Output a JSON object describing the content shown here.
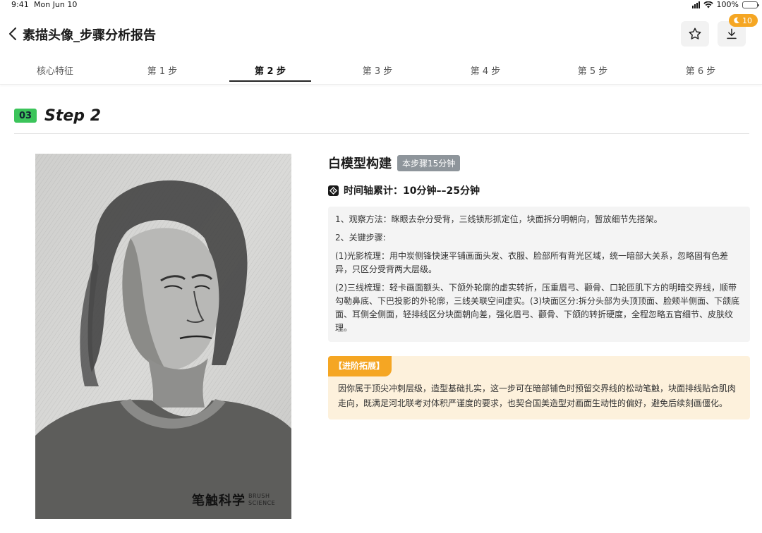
{
  "status_bar": {
    "time": "9:41",
    "date": "Mon Jun 10",
    "battery": "100%"
  },
  "header": {
    "title": "素描头像_步骤分析报告",
    "badge_count": "10"
  },
  "tabs": [
    {
      "label": "核心特征"
    },
    {
      "label": "第 1 步"
    },
    {
      "label": "第 2 步"
    },
    {
      "label": "第 3 步"
    },
    {
      "label": "第 4 步"
    },
    {
      "label": "第 5 步"
    },
    {
      "label": "第 6 步"
    }
  ],
  "active_tab": 2,
  "step": {
    "number": "03",
    "label": "Step 2"
  },
  "image": {
    "watermark_cn": "笔触科学",
    "watermark_en_1": "BRUSH",
    "watermark_en_2": "SCIENCE"
  },
  "stage": {
    "title": "白模型构建",
    "duration_tag": "本步骤15分钟",
    "timeline": "时间轴累计：10分钟––25分钟"
  },
  "method": {
    "p1": "1、观察方法：眯眼去杂分受背，三线锁形抓定位，块面拆分明朝向，暂放细节先搭架。",
    "p2": "2、关键步骤:",
    "p3": "(1)光影梳理：用中炭侧锋快速平铺画面头发、衣服、脸部所有背光区域，统一暗部大关系，忽略固有色差异，只区分受背两大层级。",
    "p4": "(2)三线梳理：轻卡画面额头、下颌外轮廓的虚实转折，压重眉弓、颧骨、口轮匝肌下方的明暗交界线，顺带勾勒鼻底、下巴投影的外轮廓，三线关联空间虚实。(3)块面区分:拆分头部为头顶顶面、脸颊半侧面、下颌底面、耳侧全侧面，轻排线区分块面朝向差，强化眉弓、颧骨、下颌的转折硬度，全程忽略五官细节、皮肤纹理。"
  },
  "advance": {
    "tag": "【进阶拓展】",
    "text": "因你属于顶尖冲刺层级，造型基础扎实，这一步可在暗部铺色时预留交界线的松动笔触，块面排线贴合肌肉走向，既满足河北联考对体积严谨度的要求，也契合国美造型对画面生动性的偏好，避免后续刻画僵化。"
  },
  "colors": {
    "step_badge": "#3bc45a",
    "accent": "#f5a623",
    "duration_tag": "#8e959b"
  }
}
